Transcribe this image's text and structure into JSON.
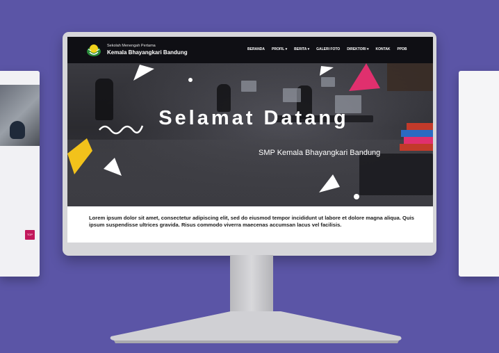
{
  "website": {
    "brand_subtitle": "Sekolah Menengah Pertama",
    "brand_title": "Kemala Bhayangkari Bandung",
    "nav": [
      {
        "label": "BERANDA",
        "has_dropdown": false
      },
      {
        "label": "PROFIL",
        "has_dropdown": true
      },
      {
        "label": "BERITA",
        "has_dropdown": true
      },
      {
        "label": "GALERI FOTO",
        "has_dropdown": false
      },
      {
        "label": "DIREKTORI",
        "has_dropdown": true
      },
      {
        "label": "KONTAK",
        "has_dropdown": false
      },
      {
        "label": "PPDB",
        "has_dropdown": false
      }
    ],
    "hero_title": "Selamat Datang",
    "hero_subtitle": "SMP Kemala Bhayangkari Bandung",
    "body_text": "Lorem ipsum dolor sit amet, consectetur adipiscing elit, sed do eiusmod tempor incididunt ut labore et dolore magna aliqua. Quis ipsum suspendisse ultrices gravida. Risus commodo viverra maecenas accumsan lacus vel facilisis."
  },
  "left_panel": {
    "top_button_label": "TOP"
  },
  "colors": {
    "background": "#5b55a6",
    "topbar": "#0f0f14",
    "accent_pink": "#e0306e",
    "accent_yellow": "#f2c21b",
    "top_button": "#c2185b"
  },
  "icons": {
    "logo": "school-emblem-icon",
    "dropdown": "chevron-down-icon"
  }
}
